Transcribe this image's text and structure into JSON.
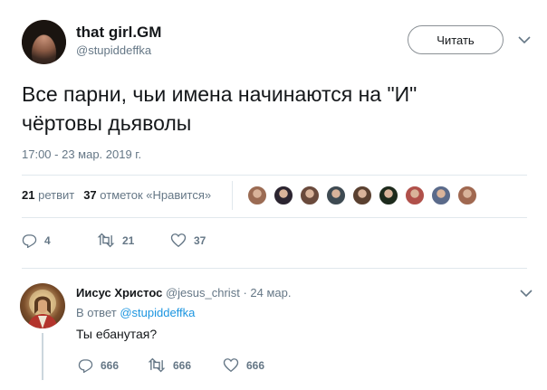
{
  "tweet": {
    "display_name": "that girl.GM",
    "username": "@stupiddeffka",
    "follow_label": "Читать",
    "text_line1": "Все парни, чьи имена начинаются на \"И\"",
    "text_line2": "чёртовы дьяволы",
    "timestamp": "17:00 - 23 мар. 2019 г.",
    "retweets_count": "21",
    "retweets_label": "ретвит",
    "likes_count": "37",
    "likes_label": "отметок «Нравится»",
    "actions": {
      "reply_count": "4",
      "retweet_count": "21",
      "like_count": "37"
    },
    "liker_colors": [
      "#9b6b53",
      "#2b2430",
      "#6a4a3c",
      "#3e4a52",
      "#5a4030",
      "#1d2a1c",
      "#b0504a",
      "#5a6a8a",
      "#a06850"
    ]
  },
  "reply": {
    "display_name": "Иисус Христос",
    "username": "@jesus_christ",
    "separator": "·",
    "date": "24 мар.",
    "in_reply_prefix": "В ответ",
    "in_reply_user": "@stupiddeffka",
    "text": "Ты ебанутая?",
    "actions": {
      "reply_count": "666",
      "retweet_count": "666",
      "like_count": "666"
    }
  },
  "colors": {
    "link": "#1b95e0",
    "secondary": "#657786",
    "primary": "#14171a"
  }
}
